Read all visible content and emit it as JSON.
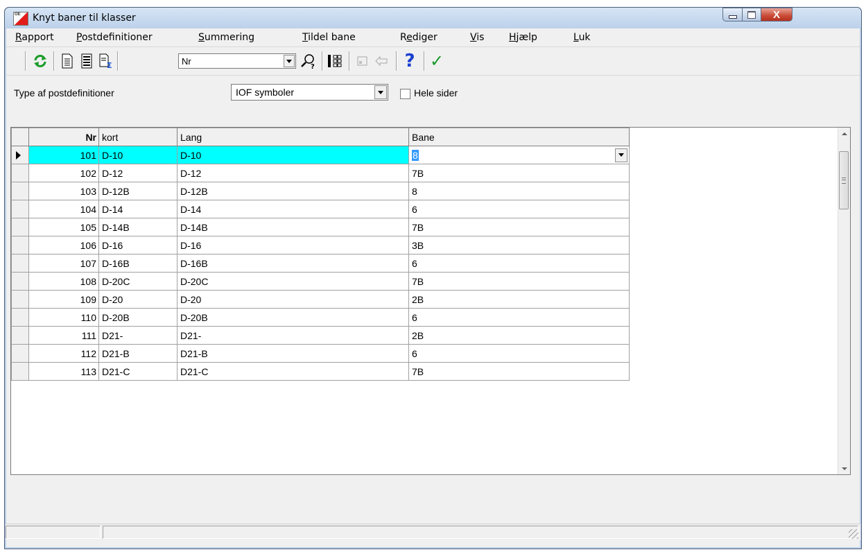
{
  "window": {
    "title": "Knyt baner til klasser",
    "close_glyph": "X"
  },
  "menu": [
    {
      "u": "R",
      "rest": "apport"
    },
    {
      "u": "P",
      "rest": "ostdefinitioner"
    },
    {
      "u": "S",
      "rest": "ummering"
    },
    {
      "u": "T",
      "rest": "ildel bane"
    },
    {
      "pre": "R",
      "u": "e",
      "rest": "diger"
    },
    {
      "u": "V",
      "rest": "is"
    },
    {
      "u": "H",
      "rest": "jælp"
    },
    {
      "u": "L",
      "rest": "uk"
    }
  ],
  "toolbar": {
    "sort_combo_value": "Nr",
    "help_glyph": "?",
    "ok_glyph": "✓"
  },
  "options": {
    "type_label": "Type af postdefinitioner",
    "type_value": "IOF symboler",
    "whole_pages_label": "Hele sider",
    "whole_pages_checked": false
  },
  "grid": {
    "headers": {
      "nr": "Nr",
      "kort": "kort",
      "lang": "Lang",
      "bane": "Bane"
    },
    "rows": [
      {
        "nr": "101",
        "kort": "D-10",
        "lang": "D-10",
        "bane": "8"
      },
      {
        "nr": "102",
        "kort": "D-12",
        "lang": "D-12",
        "bane": "7B"
      },
      {
        "nr": "103",
        "kort": "D-12B",
        "lang": "D-12B",
        "bane": "8"
      },
      {
        "nr": "104",
        "kort": "D-14",
        "lang": "D-14",
        "bane": "6"
      },
      {
        "nr": "105",
        "kort": "D-14B",
        "lang": "D-14B",
        "bane": "7B"
      },
      {
        "nr": "106",
        "kort": "D-16",
        "lang": "D-16",
        "bane": "3B"
      },
      {
        "nr": "107",
        "kort": "D-16B",
        "lang": "D-16B",
        "bane": "6"
      },
      {
        "nr": "108",
        "kort": "D-20C",
        "lang": "D-20C",
        "bane": "7B"
      },
      {
        "nr": "109",
        "kort": "D-20",
        "lang": "D-20",
        "bane": "2B"
      },
      {
        "nr": "110",
        "kort": "D-20B",
        "lang": "D-20B",
        "bane": "6"
      },
      {
        "nr": "111",
        "kort": "D21-",
        "lang": "D21-",
        "bane": "2B"
      },
      {
        "nr": "112",
        "kort": "D21-B",
        "lang": "D21-B",
        "bane": "6"
      },
      {
        "nr": "113",
        "kort": "D21-C",
        "lang": "D21-C",
        "bane": "7B"
      }
    ],
    "selected_index": 0,
    "selection_color": "#00ffff"
  },
  "icons": {
    "refresh": "refresh-icon",
    "page": "page-icon",
    "grid": "list-icon",
    "summary": "summary-icon",
    "search": "search-icon",
    "tree": "tree-icon",
    "help": "help-icon",
    "ok": "checkmark-icon"
  }
}
